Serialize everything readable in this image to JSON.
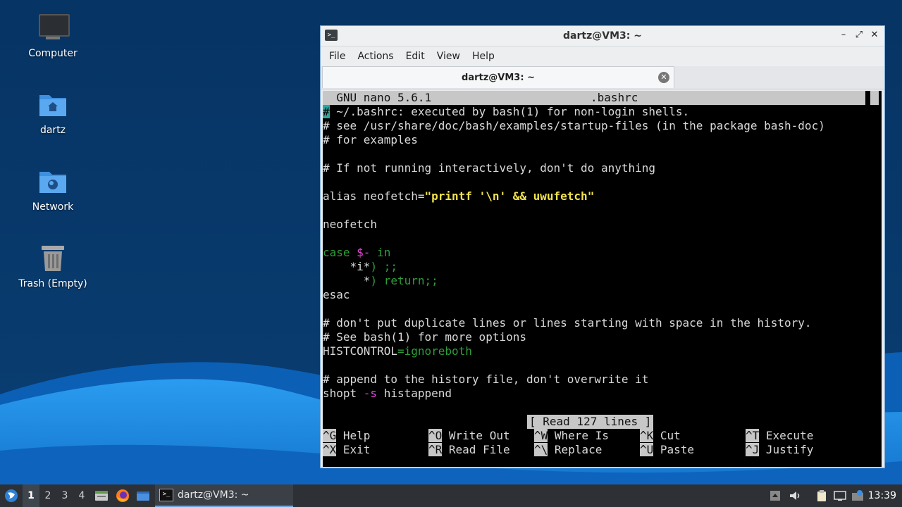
{
  "colors": {
    "desktop_top": "#063464",
    "desktop_wave_light": "#1a8fe8",
    "desktop_wave_dark": "#0b5fb5",
    "taskbar": "#2d3136",
    "terminal_bg": "#000000",
    "comment": "#2aa8a0",
    "keyword": "#2e9e3a",
    "string": "#f2e34c"
  },
  "desktop": {
    "icons": [
      {
        "label": "Computer",
        "icon": "monitor-icon"
      },
      {
        "label": "dartz",
        "icon": "home-folder-icon"
      },
      {
        "label": "Network",
        "icon": "network-folder-icon"
      },
      {
        "label": "Trash (Empty)",
        "icon": "trash-icon"
      }
    ]
  },
  "window": {
    "title": "dartz@VM3: ~",
    "controls": {
      "minimize": "–",
      "maximize": "⤢",
      "close": "✕"
    },
    "menu": [
      "File",
      "Actions",
      "Edit",
      "View",
      "Help"
    ],
    "tab": {
      "label": "dartz@VM3: ~",
      "close": "✕"
    }
  },
  "nano": {
    "header_left": "  GNU nano 5.6.1",
    "header_file": ".bashrc",
    "lines": {
      "l1_cursor": "#",
      "l1_rest": " ~/.bashrc: executed by bash(1) for non-login shells.",
      "l2": "# see /usr/share/doc/bash/examples/startup-files (in the package bash-doc)",
      "l3": "# for examples",
      "l5": "# If not running interactively, don't do anything",
      "l7_a": "alias neofetch=",
      "l7_b": "\"printf '\\n' && uwufetch\"",
      "l9": "neofetch",
      "l11_a": "case ",
      "l11_b": "$-",
      "l11_c": " in",
      "l12_a": "    *i*",
      "l12_b": ") ;;",
      "l13_a": "      *",
      "l13_b": ") return;;",
      "l14": "esac",
      "l16": "# don't put duplicate lines or lines starting with space in the history.",
      "l17": "# See bash(1) for more options",
      "l18_a": "HISTCONTROL",
      "l18_b": "=ignoreboth",
      "l20": "# append to the history file, don't overwrite it",
      "l21_a": "shopt ",
      "l21_b": "-s",
      "l21_c": " histappend"
    },
    "status": "[ Read 127 lines ]",
    "shortcuts": [
      {
        "key": "^G",
        "label": " Help"
      },
      {
        "key": "^O",
        "label": " Write Out"
      },
      {
        "key": "^W",
        "label": " Where Is"
      },
      {
        "key": "^K",
        "label": " Cut"
      },
      {
        "key": "^T",
        "label": " Execute"
      },
      {
        "key": "^X",
        "label": " Exit"
      },
      {
        "key": "^R",
        "label": " Read File"
      },
      {
        "key": "^\\",
        "label": " Replace"
      },
      {
        "key": "^U",
        "label": " Paste"
      },
      {
        "key": "^J",
        "label": " Justify"
      }
    ]
  },
  "taskbar": {
    "workspaces": [
      "1",
      "2",
      "3",
      "4"
    ],
    "active_workspace": "1",
    "task_label": "dartz@VM3: ~",
    "clock": "13:39"
  }
}
